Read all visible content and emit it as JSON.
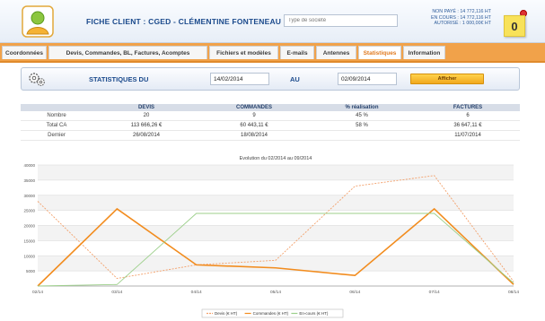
{
  "header": {
    "title": "FICHE CLIENT : CGED - CLÉMENTINE FONTENEAU",
    "company_placeholder": "Type de société",
    "status_lines": [
      "NON PAYÉ : 14 772,116 HT",
      "EN COURS : 14 772,116 HT",
      "AUTORISÉ : 1 000,00€ HT"
    ],
    "note_count": "0"
  },
  "tabs": [
    {
      "label": "Coordonnées",
      "active": false
    },
    {
      "label": "Devis, Commandes, BL, Factures, Acomptes",
      "active": false
    },
    {
      "label": "Fichiers et modèles",
      "active": false
    },
    {
      "label": "E-mails",
      "active": false
    },
    {
      "label": "Antennes",
      "active": false
    },
    {
      "label": "Statistiques",
      "active": true
    },
    {
      "label": "Information",
      "active": false
    }
  ],
  "stats_panel": {
    "label": "STATISTIQUES DU",
    "date_from": "14/02/2014",
    "au_label": "AU",
    "date_to": "02/09/2014",
    "show_button": "Afficher"
  },
  "table": {
    "headers": [
      "",
      "DEVIS",
      "COMMANDES",
      "% réalisation",
      "FACTURES"
    ],
    "rows": [
      [
        "Nombre",
        "20",
        "9",
        "45 %",
        "6"
      ],
      [
        "Total CA",
        "113 666,26 €",
        "60 443,11 €",
        "58 %",
        "36 647,11 €"
      ],
      [
        "Dernier",
        "26/08/2014",
        "18/08/2014",
        "",
        "11/07/2014"
      ]
    ]
  },
  "colors": {
    "accent": "#f1a24a",
    "brand": "#1b4a8c",
    "devis": "#f3a06a",
    "commandes": "#f28c1e",
    "en_cours": "#9ccf8a"
  },
  "chart_data": {
    "type": "line",
    "title": "Evolution du 02/2014 au 09/2014",
    "categories": [
      "02/14",
      "03/14",
      "04/14",
      "05/14",
      "06/14",
      "07/14",
      "08/14"
    ],
    "ylim": [
      0,
      40000
    ],
    "yticks": [
      5000,
      10000,
      15000,
      20000,
      25000,
      30000,
      35000,
      40000
    ],
    "grid": true,
    "legend_position": "bottom",
    "series": [
      {
        "name": "Devis (€ HT)",
        "color": "#f3a06a",
        "dashed": true,
        "values": [
          28000,
          2500,
          7000,
          8500,
          33000,
          36500,
          1500
        ]
      },
      {
        "name": "Commandes (€ HT)",
        "color": "#f28c1e",
        "dashed": false,
        "values": [
          0,
          25500,
          7000,
          6000,
          3500,
          25500,
          500
        ]
      },
      {
        "name": "En-cours (€ HT)",
        "color": "#9ccf8a",
        "dashed": false,
        "values": [
          0,
          500,
          24000,
          24000,
          24000,
          24000,
          1000
        ]
      }
    ]
  }
}
